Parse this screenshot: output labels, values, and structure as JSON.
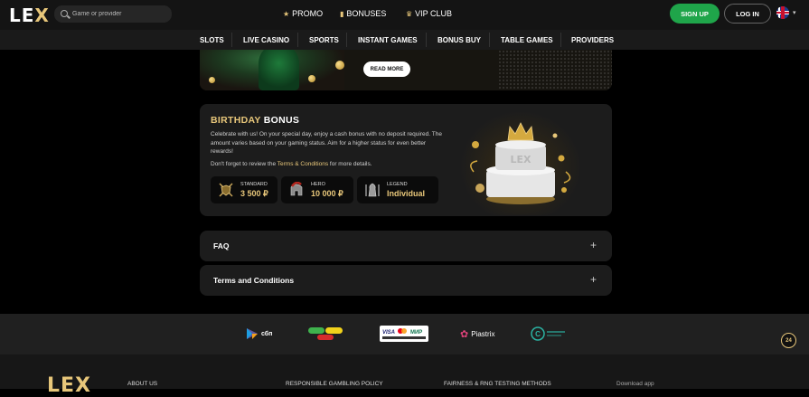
{
  "header": {
    "logo_text": "LE",
    "logo_accent": "X",
    "search_placeholder": "Game or provider",
    "nav": [
      {
        "label": "PROMO",
        "icon": "star-icon"
      },
      {
        "label": "BONUSES",
        "icon": "gift-icon"
      },
      {
        "label": "VIP CLUB",
        "icon": "crown-icon"
      }
    ],
    "signup_label": "SIGN UP",
    "login_label": "LOG IN",
    "language_icon": "uk-flag-icon"
  },
  "categories": [
    "SLOTS",
    "LIVE CASINO",
    "SPORTS",
    "INSTANT GAMES",
    "BONUS BUY",
    "TABLE GAMES",
    "PROVIDERS"
  ],
  "banner": {
    "read_more_label": "READ MORE"
  },
  "birthday": {
    "title_gold": "BIRTHDAY",
    "title_white": "BONUS",
    "description": "Celebrate with us! On your special day, enjoy a cash bonus with no deposit required. The amount varies based on your gaming status. Aim for a higher status for even better rewards!",
    "note_prefix": "Don't forget to review the ",
    "note_link": "Terms & Conditions",
    "note_suffix": " for more details.",
    "tiers": [
      {
        "label": "STANDARD",
        "value": "3 500 ₽",
        "icon": "shield-swords-icon"
      },
      {
        "label": "HERO",
        "value": "10 000 ₽",
        "icon": "spartan-helmet-icon"
      },
      {
        "label": "LEGEND",
        "value": "Individual",
        "icon": "knight-armor-icon"
      }
    ]
  },
  "accordion": [
    {
      "title": "FAQ"
    },
    {
      "title": "Terms and Conditions"
    }
  ],
  "payments": {
    "sbp": "сбп",
    "piastrix": "Piastrix",
    "visa": "VISA",
    "mir": "МИР"
  },
  "support_label": "24",
  "footer": {
    "logo": "LEX",
    "links": [
      "ABOUT US",
      "RESPONSIBLE GAMBLING POLICY",
      "FAIRNESS & RNG TESTING METHODS",
      "Download app"
    ]
  },
  "colors": {
    "gold": "#e8c77a",
    "signup_green": "#1fa54a",
    "card_bg": "#1c1c1c"
  }
}
